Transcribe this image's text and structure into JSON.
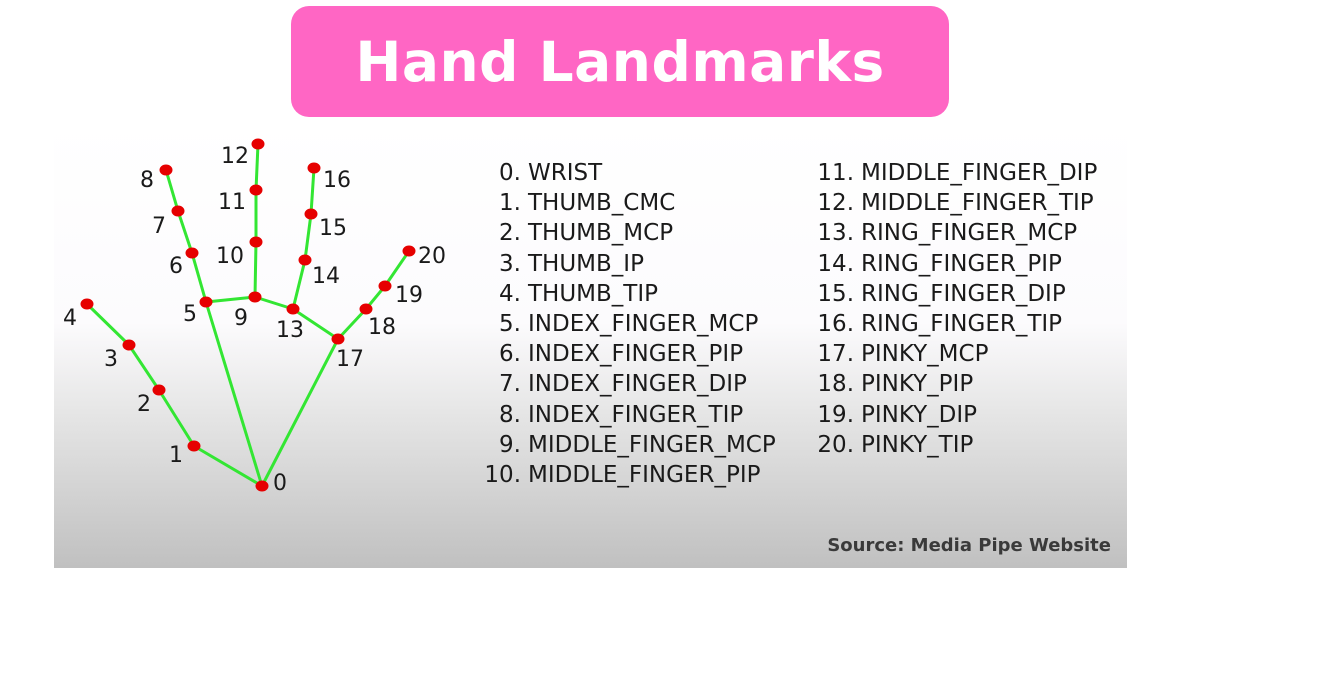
{
  "title": "Hand Landmarks",
  "source": "Source: Media Pipe Website",
  "colors": {
    "title_background": "#ff66c4",
    "bone": "#33e633",
    "joint": "#e60000"
  },
  "landmarks": [
    {
      "id": "0",
      "name": "WRIST"
    },
    {
      "id": "1",
      "name": "THUMB_CMC"
    },
    {
      "id": "2",
      "name": "THUMB_MCP"
    },
    {
      "id": "3",
      "name": "THUMB_IP"
    },
    {
      "id": "4",
      "name": "THUMB_TIP"
    },
    {
      "id": "5",
      "name": "INDEX_FINGER_MCP"
    },
    {
      "id": "6",
      "name": "INDEX_FINGER_PIP"
    },
    {
      "id": "7",
      "name": "INDEX_FINGER_DIP"
    },
    {
      "id": "8",
      "name": "INDEX_FINGER_TIP"
    },
    {
      "id": "9",
      "name": "MIDDLE_FINGER_MCP"
    },
    {
      "id": "10",
      "name": "MIDDLE_FINGER_PIP"
    },
    {
      "id": "11",
      "name": "MIDDLE_FINGER_DIP"
    },
    {
      "id": "12",
      "name": "MIDDLE_FINGER_TIP"
    },
    {
      "id": "13",
      "name": "RING_FINGER_MCP"
    },
    {
      "id": "14",
      "name": "RING_FINGER_PIP"
    },
    {
      "id": "15",
      "name": "RING_FINGER_DIP"
    },
    {
      "id": "16",
      "name": "RING_FINGER_TIP"
    },
    {
      "id": "17",
      "name": "PINKY_MCP"
    },
    {
      "id": "18",
      "name": "PINKY_PIP"
    },
    {
      "id": "19",
      "name": "PINKY_DIP"
    },
    {
      "id": "20",
      "name": "PINKY_TIP"
    }
  ],
  "connections": [
    [
      0,
      1
    ],
    [
      1,
      2
    ],
    [
      2,
      3
    ],
    [
      3,
      4
    ],
    [
      0,
      5
    ],
    [
      5,
      6
    ],
    [
      6,
      7
    ],
    [
      7,
      8
    ],
    [
      5,
      9
    ],
    [
      9,
      10
    ],
    [
      10,
      11
    ],
    [
      11,
      12
    ],
    [
      9,
      13
    ],
    [
      13,
      14
    ],
    [
      14,
      15
    ],
    [
      15,
      16
    ],
    [
      13,
      17
    ],
    [
      0,
      17
    ],
    [
      17,
      18
    ],
    [
      18,
      19
    ],
    [
      19,
      20
    ]
  ]
}
